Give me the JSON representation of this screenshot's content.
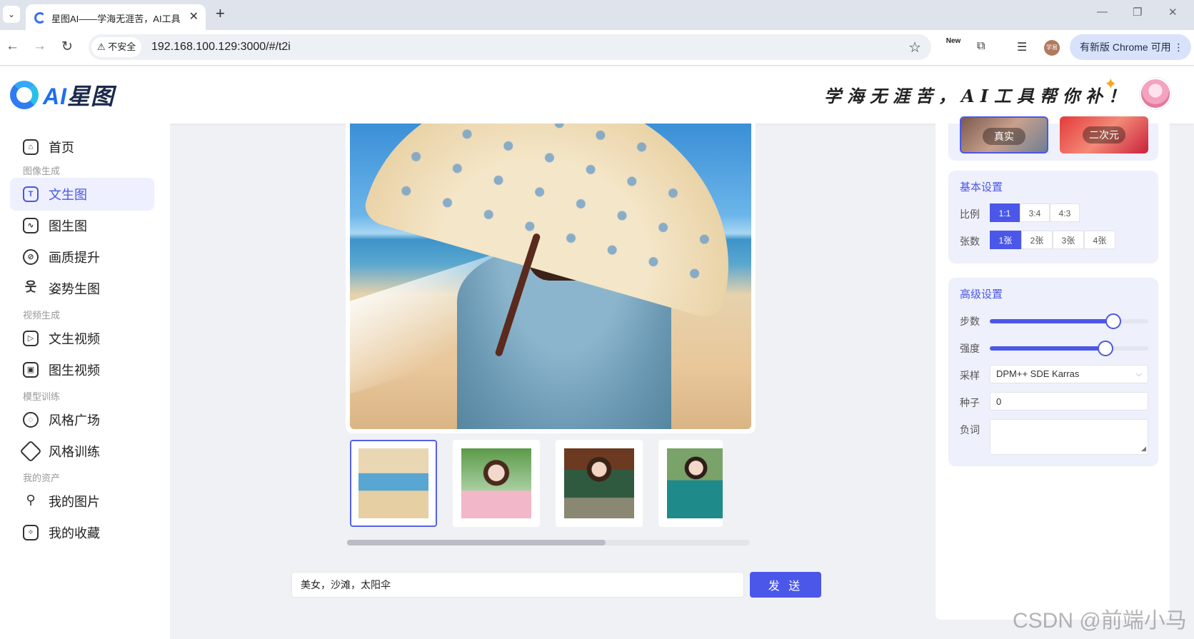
{
  "browser": {
    "tab_title": "星图AI——学海无涯苦，AI工具",
    "security_label": "不安全",
    "url": "192.168.100.129:3000/#/t2i",
    "ext_new_label": "New",
    "profile_label": "学易",
    "update_label": "有新版 Chrome 可用"
  },
  "header": {
    "logo_ai": "AI",
    "logo_name": "星图",
    "slogan": "学海无涯苦，AI工具帮你补！"
  },
  "sidebar": {
    "home": "首页",
    "group_image": "图像生成",
    "text_to_image": "文生图",
    "image_to_image": "图生图",
    "upscale": "画质提升",
    "pose_to_image": "姿势生图",
    "group_video": "视频生成",
    "text_to_video": "文生视频",
    "image_to_video": "图生视频",
    "group_training": "模型训练",
    "style_square": "风格广场",
    "style_training": "风格训练",
    "group_assets": "我的资产",
    "my_images": "我的图片",
    "my_favorites": "我的收藏"
  },
  "main": {
    "prompt_value": "美女，沙滩，太阳伞",
    "send_label": "发 送"
  },
  "styles": {
    "real": "真实",
    "anime": "二次元"
  },
  "basic": {
    "title": "基本设置",
    "ratio_label": "比例",
    "ratios": [
      "1:1",
      "3:4",
      "4:3"
    ],
    "count_label": "张数",
    "counts": [
      "1张",
      "2张",
      "3张",
      "4张"
    ]
  },
  "advanced": {
    "title": "高级设置",
    "steps_label": "步数",
    "steps_level": 0.78,
    "strength_label": "强度",
    "strength_level": 0.73,
    "sampler_label": "采样",
    "sampler_value": "DPM++ SDE Karras",
    "seed_label": "种子",
    "seed_value": "0",
    "negative_label": "负词"
  },
  "watermark": "CSDN @前端小马",
  "colors": {
    "accent": "#4b57e8",
    "active_bg": "#eef0ff"
  }
}
